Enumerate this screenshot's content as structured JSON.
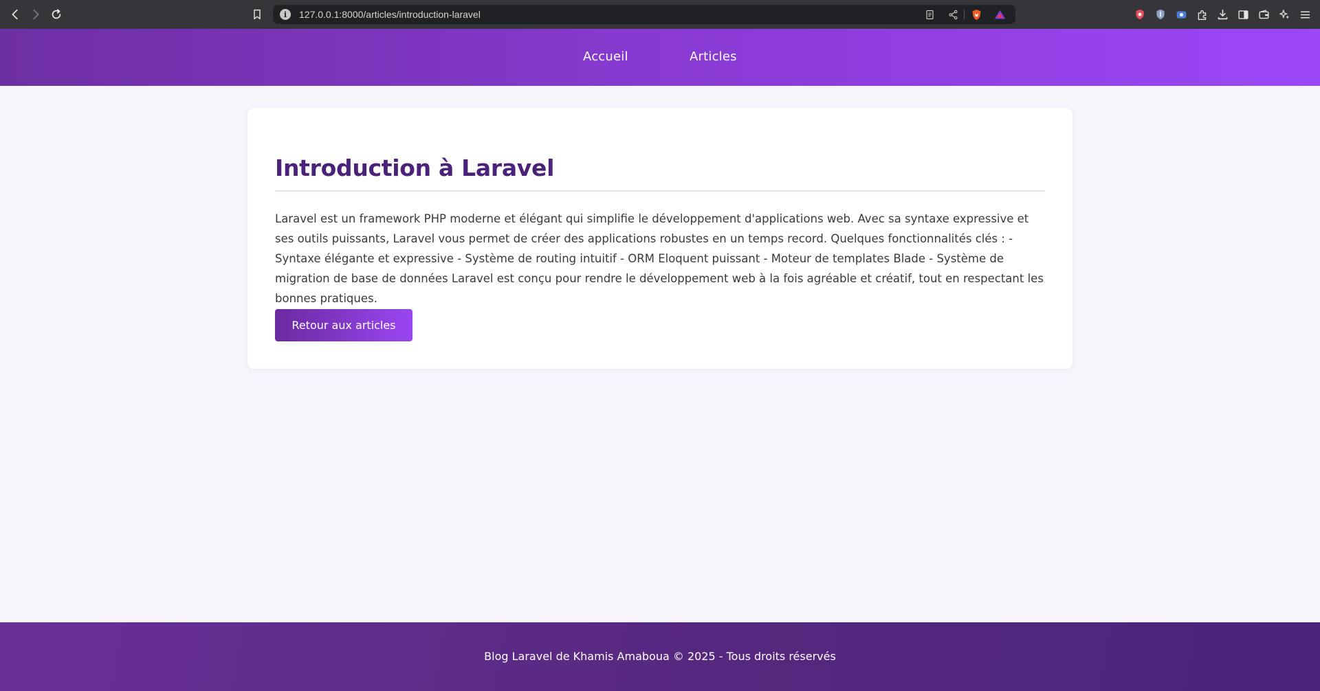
{
  "browser": {
    "url": "127.0.0.1:8000/articles/introduction-laravel",
    "icons": [
      "back-icon",
      "forward-icon",
      "reload-icon",
      "bookmark-icon",
      "site-info-icon",
      "reader-mode-icon",
      "share-icon",
      "brave-shields-icon",
      "brave-rewards-icon",
      "shield-extension-icon",
      "vpn-extension-icon",
      "tab-extension-icon",
      "extensions-icon",
      "downloads-icon",
      "sidebar-icon",
      "wallet-icon",
      "leo-ai-icon",
      "menu-icon"
    ]
  },
  "nav": {
    "home": "Accueil",
    "articles": "Articles"
  },
  "article": {
    "title": "Introduction à Laravel",
    "body": "Laravel est un framework PHP moderne et élégant qui simplifie le développement d'applications web. Avec sa syntaxe expressive et ses outils puissants, Laravel vous permet de créer des applications robustes en un temps record. Quelques fonctionnalités clés : - Syntaxe élégante et expressive - Système de routing intuitif - ORM Eloquent puissant - Moteur de templates Blade - Système de migration de base de données Laravel est conçu pour rendre le développement web à la fois agréable et créatif, tout en respectant les bonnes pratiques.",
    "back_button": "Retour aux articles"
  },
  "footer": {
    "text": "Blog Laravel de Khamis Amaboua © 2025 - Tous droits réservés"
  },
  "colors": {
    "header_start": "#6d2fa3",
    "header_end": "#9b47f7",
    "title": "#4a2279",
    "footer": "#56287f",
    "background": "#f7f4fc"
  }
}
